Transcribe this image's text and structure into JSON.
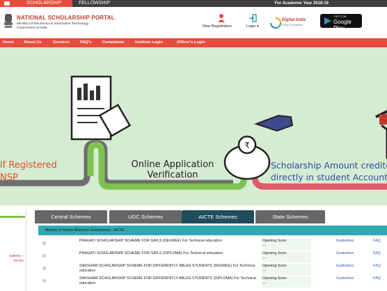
{
  "topbar": {
    "tabs": [
      "SCHOLARSHIP",
      "FELLOWSHIP"
    ],
    "academic_year": "For Academic Year 2018-19"
  },
  "header": {
    "title": "NATIONAL SCHOLARSHIP PORTAL",
    "subtitle_line1": "Ministry Of Electronics & Information Technology,",
    "subtitle_line2": "Government of India",
    "new_registration": "New Registration",
    "login": "Login",
    "digital_india": "Digital India",
    "digital_india_tagline": "Power To Empower",
    "gplay_get": "GET IT ON",
    "gplay_name": "Google Play"
  },
  "nav": {
    "items": [
      "Home",
      "About Us",
      "Services",
      "FAQ's",
      "Complaints",
      "Institute Login",
      "Officer's Login"
    ]
  },
  "hero": {
    "step1": [
      "elf Registered",
      "NSP"
    ],
    "step2": [
      "Online Application",
      "Verification"
    ],
    "step3": [
      "Scholarship Amount credite",
      "directly in student Account"
    ]
  },
  "sidebar": {
    "text_line1": "tudents –",
    "text_line2": "for the"
  },
  "tabs": [
    "Central Schemes",
    "UGC Schemes",
    "AICTE Schemes",
    "State Schemes"
  ],
  "panel": {
    "heading": "Ministry of Human Resource Development - AICTE"
  },
  "schemes": [
    {
      "name": "PRAGATI SCHOLARSHIP SCHEME FOR GIRLS (DEGREE) For Technical education",
      "status": "Opening Soon",
      "status2": "---",
      "guidelines": "Guidelines",
      "faq": "FAQ"
    },
    {
      "name": "PRAGATI SCHOLARSHIP SCHEME FOR GIRLS (DIPLOMA) For Technical education",
      "status": "Opening Soon",
      "status2": "---",
      "guidelines": "Guidelines",
      "faq": "FAQ"
    },
    {
      "name": "SAKSHAM SCHOLARSHIP SCHEME FOR DIFFERENTLY ABLED STUDENTS (DEGREE) For Technical education",
      "status": "Opening Soon",
      "status2": "---",
      "guidelines": "Guidelines",
      "faq": "FAQ"
    },
    {
      "name": "SAKSHAM SCHOLARSHIP SCHEME FOR DIFFERENTLY ABLED STUDENTS (DIPLOMA) For Technical education",
      "status": "Opening Soon",
      "status2": "---",
      "guidelines": "Guidelines",
      "faq": "FAQ"
    }
  ],
  "colors": {
    "accent_red": "#e74c3c",
    "hero_bg": "#d6ecd2",
    "active_tab": "#1e4d5c",
    "panel_head": "#2ea9b3"
  }
}
